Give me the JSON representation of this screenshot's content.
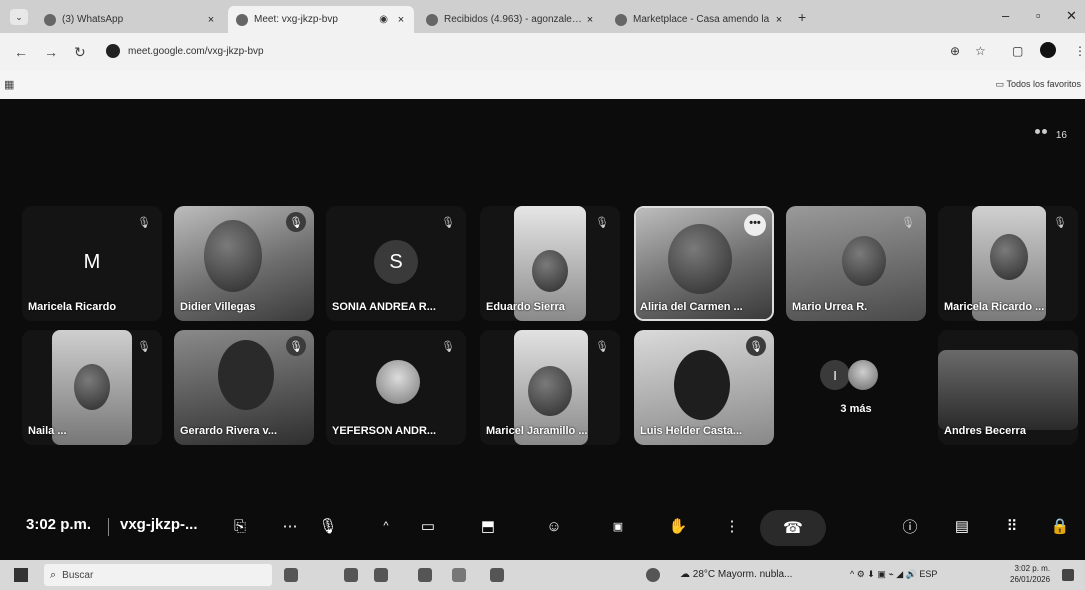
{
  "browser": {
    "tabs": [
      {
        "label": "(3) WhatsApp",
        "active": false
      },
      {
        "label": "Meet: vxg-jkzp-bvp",
        "active": true
      },
      {
        "label": "Recibidos (4.963) - agonzalez...",
        "active": false
      },
      {
        "label": "Marketplace - Casa amendo la",
        "active": false
      }
    ],
    "tab_close_glyph": "×",
    "url": "meet.google.com/vxg-jkzp-bvp",
    "favorites_label": "Todos los favoritos"
  },
  "meeting": {
    "participant_count": "16",
    "participants_row1": [
      {
        "name": "Maricela Ricardo",
        "initial": "M",
        "type": "avatar"
      },
      {
        "name": "Didier Villegas",
        "type": "video"
      },
      {
        "name": "SONIA ANDREA R...",
        "initial": "S",
        "type": "avatar"
      },
      {
        "name": "Eduardo Sierra",
        "type": "video"
      },
      {
        "name": "Aliria del Carmen ...",
        "type": "video"
      },
      {
        "name": "Mario Urrea R.",
        "type": "video"
      },
      {
        "name": "Maricela Ricardo ...",
        "type": "video"
      }
    ],
    "participants_row2": [
      {
        "name": "Naila ...",
        "type": "video"
      },
      {
        "name": "Gerardo Rivera v...",
        "type": "video"
      },
      {
        "name": "YEFERSON ANDR...",
        "type": "video"
      },
      {
        "name": "Maricel Jaramillo ...",
        "type": "video"
      },
      {
        "name": "Luis Helder Casta...",
        "type": "video"
      },
      {
        "name": "3 más",
        "type": "more"
      },
      {
        "name": "Andres Becerra",
        "type": "video"
      }
    ],
    "more_initial": "I",
    "time": "3:02 p.m.",
    "code": "vxg-jkzp-..."
  },
  "taskbar": {
    "search_placeholder": "Buscar",
    "weather": "28°C Mayorm. nubla...",
    "tray_lang": "ESP",
    "clock_time": "3:02 p. m.",
    "clock_date": "26/01/2026"
  }
}
